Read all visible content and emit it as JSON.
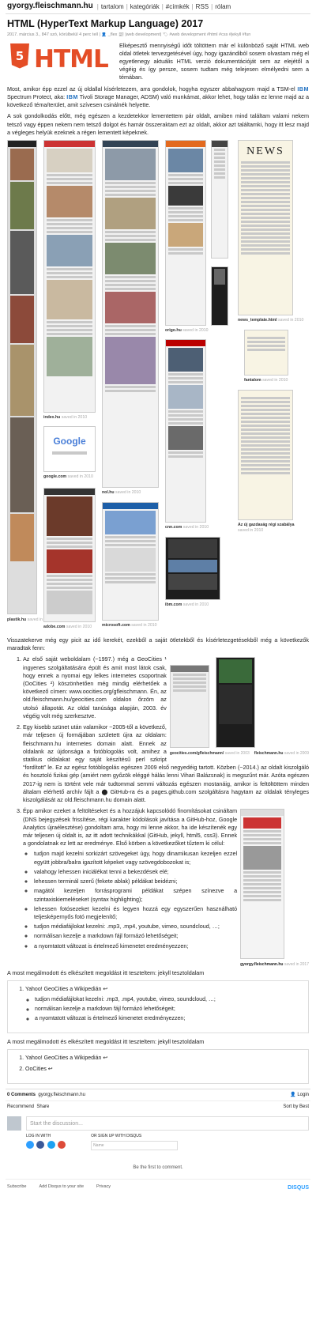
{
  "site": {
    "name": "gyorgy.fleischmann.hu"
  },
  "nav": [
    "tartalom",
    "kategóriák",
    "#címkék",
    "RSS",
    "rólam"
  ],
  "post": {
    "title": "HTML (HyperText Markup Language) 2017",
    "meta": "2017. március 3., 847 szó, körülbelül 4 perc tell | 👤 _flex 📰 |web development| 🏷 #web development #html #css #jekyll #fun",
    "logo_text": "HTML",
    "logo_shield": "5",
    "p1": "Elképesztő mennyiségű időt töltöttem már el különböző saját HTML web oldal ötletek tervezgetésével úgy, hogy igazándiból sosem olvastam még el egyetlenegy aktuális HTML verzió dokumentációját sem az elejétől a végéig és így persze, sosem tudtam még telejesen elmélyedni sem a témában.",
    "p2_a": "Most, amikor épp ezzel az új oldallal kísérletezem, arra gondolok, hogyha egyszer abbahagyom majd a TSM-el",
    "p2_ibm1": "IBM",
    "p2_b": "Spectrum Protect, aka:",
    "p2_ibm2": "IBM",
    "p2_c": "Tivoli Storage Manager, ADSM) való munkámat, akkor lehet, hogy talán ez lenne majd az a következő téma/terület, amit szívesen csinálnék helyette.",
    "p3": "A sok gondolkodás előtt, még egészen a kezdetekkor lementettem pár oldalt, amiben mind találtam valami nekem tetsző vagy éppen nekem nem tetsző dolgot és hamár összeraktam ezt az oldalt, akkor azt találtamki, hogy itt lesz majd a végleges helyük ezeknek a régen lementett képeknek.",
    "p4": "Visszatekerve még egy picit az idő kerekét, ezekből a saját ötletekből és kísérletezgetésekből még a következők maradtak fenn:",
    "list_item_1": "Az első saját weboldalam (~1997.) még a GeoCities ¹ ingyenes szolgáltatására épült és amit most látok csak, hogy ennek a nyomai egy lelkes internetes csoportnak (OoCities ²) köszönhetően még mindig elérhetőek a következő címen: www.oocities.org/gfleischmann. Én, az old.fleischmann.hu/geocities.com oldalon őrzöm az utolsó állapotát. Az oldal tanúsága alapján, 2003. év végéig volt még szerkesztve.",
    "list_item_2": "Egy kisebb szünet után valamikor ~2005-től a következő, már teljesen új formájában született újra az oldalam: fleischmann.hu internetes domain alatt. Ennek az oldalank az újdonsága a fotóblogolás volt, amihez a statikus oldalakat egy saját készítésű perl szkript “fordított” le. Ez az egész fotóblogolás egészen 2009 első negyedéig tartott. Közben (~2014.) az oldalt kiszolgáló és hosztoló fizikai gép (amiért nem győzök eléggé hálás lenni Vihari Balázsnak) is megszűnt már. Azóta egészen 2017-ig nem is történt vele már tudtommal semmi változás egészen mostanáig, amikor is feltöltöttem minden általam elérhető archív fájlt a ⬤ GitHub-ra és a pages.github.com szolgáltásra hagytam az oldalak tényleges kiszolgálását az old.fleischmann.hu domain alatt.",
    "list_item_3": "Épp amikor ezeket a feltöltéseket és a hozzájuk kapcsolódó finomításokat csináltam (DNS bejegyzések frissítése, régi karakter kódolások javítása a GitHub-hoz, Google Analytics újraélesztése) gondoltam arra, hogy mi lenne akkor, ha ide készítenék egy már teljesen új oldalt is, az itt adott technikákkal (GitHub, jekyll, html5, css3). Ennek a gondolatnak ez lett az eredménye. Első körben a következőket tűztem ki célul:",
    "goals": [
      "tudjon majd kezelni sorkizárt szövegeket úgy, hogy dinamikusan kezeljen ezzel együtt jobbra/balra igazított képeket vagy szövegdobozokat is;",
      "valahogy lehessen iniciálékat tenni a bekezdések elé;",
      "lehessen terminál szerű (fekete ablak) példákat beidézni;",
      "magától kezeljen forrásprogrami példákat szépen színezve a szintaxiskiemeléseket (syntax highlighting);",
      "lehessen fotósezeket kezelni és legyen hozzá egy egyszerűen használható teljesképernyős fotó megjelenítő;",
      "tudjon médiafájlokat kezelni: .mp3, .mp4, youtube, vimeo, soundcloud, …;",
      "normálisan kezelje a markdown fájl formázó lehetőségeit;",
      "a nyomtatott változat is értelmező kimenetet eredményezzen;"
    ],
    "p5": "A most megálmodott és elkészített megoldást itt teszteltem: jekyll tesztoldalam"
  },
  "gallery": [
    {
      "caption": "plastik.hu",
      "saved": "saved in 2010"
    },
    {
      "caption": "index.hu",
      "saved": "saved in 2010"
    },
    {
      "caption": "origo.hu",
      "saved": "saved in 2010"
    },
    {
      "caption": "news_template.html",
      "saved": "saved in 2010"
    },
    {
      "caption": "fantalom",
      "saved": "saved in 2010"
    },
    {
      "caption": "google.com",
      "saved": "saved in 2010"
    },
    {
      "caption": "nol.hu",
      "saved": "saved in 2010"
    },
    {
      "caption": "cnn.com",
      "saved": "saved in 2010"
    },
    {
      "caption": "Az új gazdaság régi szabálya",
      "saved": "saved in 2010"
    },
    {
      "caption": "adobe.com",
      "saved": "saved in 2010"
    },
    {
      "caption": "microsoft.com",
      "saved": "saved in 2010"
    },
    {
      "caption": "ibm.com",
      "saved": "saved in 2010"
    },
    {
      "caption": "geocities.com/gfleischmann/",
      "saved": "saved in 2003"
    },
    {
      "caption": "fleischmann.hu",
      "saved": "saved in 2009"
    },
    {
      "caption": "gyorgy.fleischmann.hu",
      "saved": "saved in 2017"
    }
  ],
  "gallery_news_label": "NEWS",
  "gallery_google_label": "Google",
  "jekyll_box": {
    "items": [
      "Yahoo! GeoCities a Wikipedián",
      "OoCities"
    ],
    "sub": [
      "tudjon médiafájlokat kezelni: .mp3, .mp4, youtube, vimeo, soundcloud, …;",
      "normálisan kezelje a markdown fájl formázó lehetőségeit;",
      "a nyomtatott változat is értelmező kimenetet eredményezzen;"
    ],
    "repeat_text": "A most megálmodott és elkészített megoldást itt teszteltem: jekyll tesztoldalam",
    "back_icon": "↩"
  },
  "disqus": {
    "comments_label": "0 Comments",
    "site_label": "gyorgy.fleischmann.hu",
    "login_label": "Login",
    "recommend_label": "Recommend",
    "share_label": "Share",
    "sort_label": "Sort by Best",
    "placeholder": "Start the discussion...",
    "login_with": "LOG IN WITH",
    "or_signup": "OR SIGN UP WITH DISQUS",
    "name_placeholder": "Name",
    "first_comment": "Be the first to comment.",
    "subscribe": "Subscribe",
    "add_disqus": "Add Disqus to your site",
    "privacy": "Privacy",
    "brand": "DISQUS"
  }
}
